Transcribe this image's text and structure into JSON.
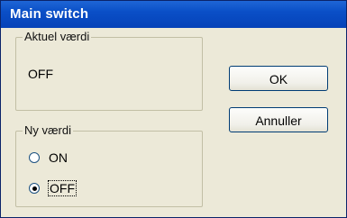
{
  "window": {
    "title": "Main switch"
  },
  "current": {
    "legend": "Aktuel værdi",
    "value": "OFF"
  },
  "new_value": {
    "legend": "Ny værdi",
    "options": [
      {
        "label": "ON",
        "selected": false
      },
      {
        "label": "OFF",
        "selected": true
      }
    ]
  },
  "buttons": {
    "ok": "OK",
    "cancel": "Annuller"
  }
}
